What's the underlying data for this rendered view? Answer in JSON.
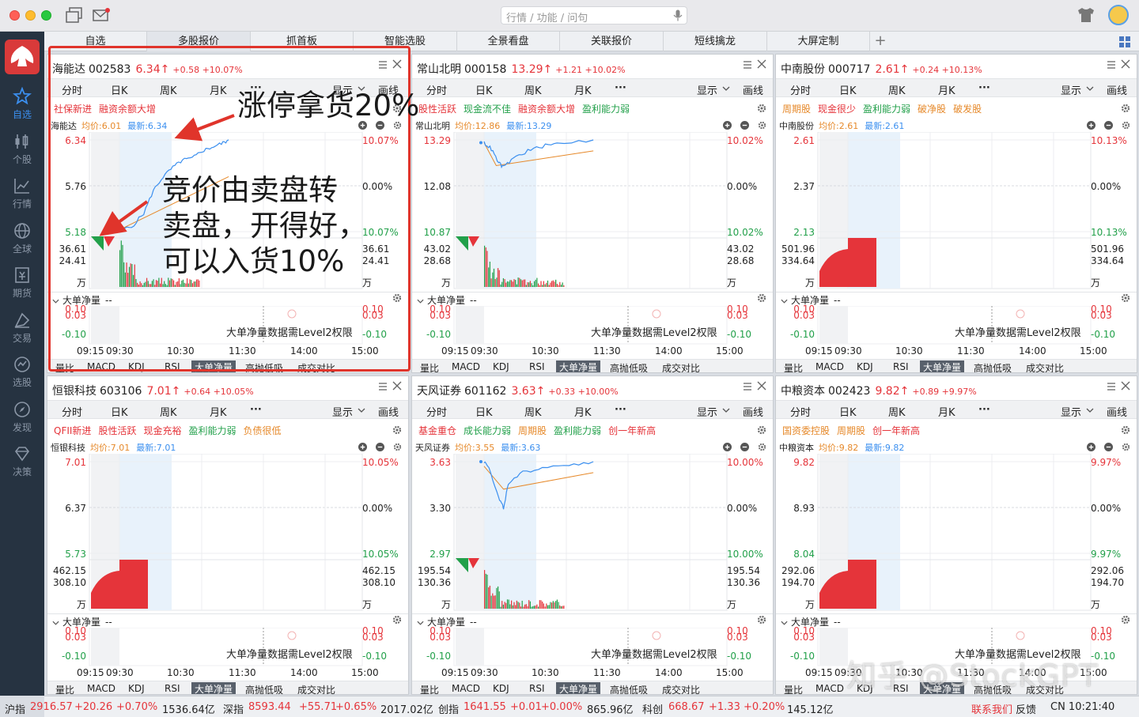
{
  "search": {
    "placeholder": "行情 / 功能 / 问句"
  },
  "sidebar": {
    "items": [
      {
        "label": "自选",
        "icon": "star-icon",
        "active": true
      },
      {
        "label": "个股",
        "icon": "candlestick-icon"
      },
      {
        "label": "行情",
        "icon": "line-chart-icon"
      },
      {
        "label": "全球",
        "icon": "globe-icon"
      },
      {
        "label": "期货",
        "icon": "futures-icon"
      },
      {
        "label": "交易",
        "icon": "trade-icon"
      },
      {
        "label": "选股",
        "icon": "select-stock-icon"
      },
      {
        "label": "发现",
        "icon": "compass-icon"
      },
      {
        "label": "决策",
        "icon": "diamond-icon"
      }
    ]
  },
  "tabs": [
    "自选",
    "多股报价",
    "抓首板",
    "智能选股",
    "全景看盘",
    "关联报价",
    "短线擒龙",
    "大屏定制"
  ],
  "tab_add": "+",
  "panel_common": {
    "tabs": [
      "分时",
      "日K",
      "周K",
      "月K",
      "···",
      "显示",
      "画线"
    ],
    "sub_title": "大单净量",
    "sub_value": "--",
    "level2": "大单净量数据需Level2权限",
    "sub_top": "0.10",
    "sub_top2": "0.03",
    "sub_bot": "-0.10",
    "times": [
      "09:15",
      "09:30",
      "10:30",
      "11:30",
      "14:00",
      "15:00"
    ],
    "bottom_tabs": [
      "量比",
      "MACD",
      "KDJ",
      "RSI",
      "大单净量",
      "高抛低吸",
      "成交对比"
    ],
    "unit": "万",
    "zero_pct": "0.00%"
  },
  "panels": [
    {
      "name": "海能达",
      "code": "002583",
      "price": "6.34↑",
      "change": "+0.58 +10.07%",
      "tags": [
        {
          "t": "社保新进",
          "c": "red"
        },
        {
          "t": "融资余额大增",
          "c": "red"
        }
      ],
      "legend_name": "海能达",
      "avg": "均价:6.01",
      "latest": "最新:6.34",
      "hi": "6.34",
      "mid": "5.76",
      "lo": "5.18",
      "hi_pct": "10.07%",
      "lo_pct": "10.07%",
      "vol1": "36.61",
      "vol2": "24.41"
    },
    {
      "name": "常山北明",
      "code": "000158",
      "price": "13.29↑",
      "change": "+1.21 +10.02%",
      "tags": [
        {
          "t": "股性活跃",
          "c": "red"
        },
        {
          "t": "现金流不佳",
          "c": "grn"
        },
        {
          "t": "融资余额大增",
          "c": "red"
        },
        {
          "t": "盈利能力弱",
          "c": "grn"
        }
      ],
      "legend_name": "常山北明",
      "avg": "均价:12.86",
      "latest": "最新:13.29",
      "hi": "13.29",
      "mid": "12.08",
      "lo": "10.87",
      "hi_pct": "10.02%",
      "lo_pct": "10.02%",
      "vol1": "43.02",
      "vol2": "28.68"
    },
    {
      "name": "中南股份",
      "code": "000717",
      "price": "2.61↑",
      "change": "+0.24 +10.13%",
      "tags": [
        {
          "t": "周期股",
          "c": "org"
        },
        {
          "t": "现金很少",
          "c": "red"
        },
        {
          "t": "盈利能力弱",
          "c": "grn"
        },
        {
          "t": "破净股",
          "c": "org"
        },
        {
          "t": "破发股",
          "c": "org"
        }
      ],
      "legend_name": "中南股份",
      "avg": "均价:2.61",
      "latest": "最新:2.61",
      "hi": "2.61",
      "mid": "2.37",
      "lo": "2.13",
      "hi_pct": "10.13%",
      "lo_pct": "10.13%",
      "vol1": "501.96",
      "vol2": "334.64"
    },
    {
      "name": "恒银科技",
      "code": "603106",
      "price": "7.01↑",
      "change": "+0.64 +10.05%",
      "tags": [
        {
          "t": "QFII新进",
          "c": "red"
        },
        {
          "t": "股性活跃",
          "c": "red"
        },
        {
          "t": "现金充裕",
          "c": "red"
        },
        {
          "t": "盈利能力弱",
          "c": "grn"
        },
        {
          "t": "负债很低",
          "c": "org"
        }
      ],
      "legend_name": "恒银科技",
      "avg": "均价:7.01",
      "latest": "最新:7.01",
      "hi": "7.01",
      "mid": "6.37",
      "lo": "5.73",
      "hi_pct": "10.05%",
      "lo_pct": "10.05%",
      "vol1": "462.15",
      "vol2": "308.10"
    },
    {
      "name": "天风证券",
      "code": "601162",
      "price": "3.63↑",
      "change": "+0.33 +10.00%",
      "tags": [
        {
          "t": "基金重仓",
          "c": "red"
        },
        {
          "t": "成长能力弱",
          "c": "grn"
        },
        {
          "t": "周期股",
          "c": "org"
        },
        {
          "t": "盈利能力弱",
          "c": "grn"
        },
        {
          "t": "创一年新高",
          "c": "red"
        }
      ],
      "legend_name": "天风证券",
      "avg": "均价:3.55",
      "latest": "最新:3.63",
      "hi": "3.63",
      "mid": "3.30",
      "lo": "2.97",
      "hi_pct": "10.00%",
      "lo_pct": "10.00%",
      "vol1": "195.54",
      "vol2": "130.36"
    },
    {
      "name": "中粮资本",
      "code": "002423",
      "price": "9.82↑",
      "change": "+0.89 +9.97%",
      "tags": [
        {
          "t": "国资委控股",
          "c": "org"
        },
        {
          "t": "周期股",
          "c": "org"
        },
        {
          "t": "创一年新高",
          "c": "red"
        }
      ],
      "legend_name": "中粮资本",
      "avg": "均价:9.82",
      "latest": "最新:9.82",
      "hi": "9.82",
      "mid": "8.93",
      "lo": "8.04",
      "hi_pct": "9.97%",
      "lo_pct": "9.97%",
      "vol1": "292.06",
      "vol2": "194.70"
    }
  ],
  "statusbar": {
    "sh_name": "沪指",
    "sh_val": "2916.57",
    "sh_chg": "+20.26",
    "sh_pct": "+0.70%",
    "sh_amt": "1536.64亿",
    "sz_name": "深指",
    "sz_val": "8593.44",
    "sz_chg": "+55.71",
    "sz_pct": "+0.65%",
    "sz_amt": "2017.02亿",
    "cy_name": "创指",
    "cy_val": "1641.55",
    "cy_chg": "+0.01",
    "cy_pct": "+0.00%",
    "cy_amt": "865.96亿",
    "kc_name": "科创",
    "kc_val": "668.67",
    "kc_chg": "+1.33",
    "kc_pct": "+0.20%",
    "kc_amt": "145.12亿",
    "contact": "联系我们",
    "feedback": "反馈",
    "time": "CN 10:21:40"
  },
  "annotations": {
    "a1": "涨停拿货20%",
    "a2_l1": "竞价由卖盘转",
    "a2_l2": "卖盘，开得好，",
    "a2_l3": "可以入货10%"
  },
  "watermark": "知乎 @StockGPT",
  "colors": {
    "up": "#e5343a",
    "down": "#22a04a",
    "line": "#3b8fef",
    "avg": "#e6892a",
    "sidebar": "#263341",
    "highlight": "#e0342b"
  }
}
